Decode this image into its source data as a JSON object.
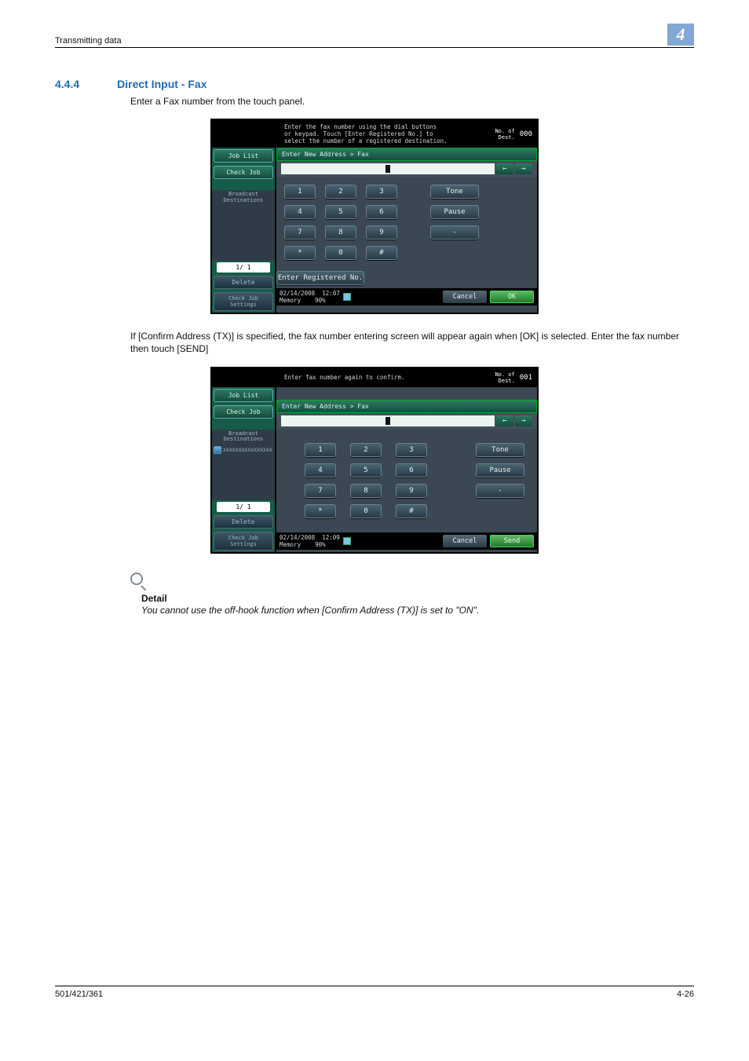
{
  "header": {
    "section": "Transmitting data",
    "chapter": "4"
  },
  "section": {
    "number": "4.4.4",
    "title": "Direct Input - Fax"
  },
  "p1": "Enter a Fax number from the touch panel.",
  "p2": "If [Confirm Address (TX)] is specified, the fax number entering screen will appear again when [OK] is selected. Enter the fax number then touch [SEND]",
  "detail": {
    "title": "Detail",
    "body": "You cannot use the off-hook function when [Confirm Address (TX)] is set to \"ON\"."
  },
  "footer": {
    "model": "501/421/361",
    "page": "4-26"
  },
  "screen1": {
    "job_list": "Job List",
    "check_job": "Check Job",
    "broadcast": "Broadcast\nDestinations",
    "page_indicator": "1/  1",
    "delete": "Delete",
    "check_settings": "Check Job\nSettings",
    "instruction": "Enter the fax number using the dial buttons\nor keypad. Touch [Enter Registered No.] to\nselect the number of a registered destination.",
    "dest_label": "No. of\nDest.",
    "dest_count": "000",
    "crumb": "Enter New Address > Fax",
    "keys": {
      "1": "1",
      "2": "2",
      "3": "3",
      "4": "4",
      "5": "5",
      "6": "6",
      "7": "7",
      "8": "8",
      "9": "9",
      "0": "0",
      "star": "*",
      "hash": "#",
      "tone": "Tone",
      "pause": "Pause",
      "dash": "-"
    },
    "enter_reg": "Enter Registered No.",
    "date": "02/14/2008",
    "time": "12:07",
    "memory_label": "Memory",
    "memory_val": "90%",
    "cancel": "Cancel",
    "ok": "OK"
  },
  "screen2": {
    "job_list": "Job List",
    "check_job": "Check Job",
    "broadcast": "Broadcast\nDestinations",
    "dest_entry": "XXXXXXXXXXXXXXXX",
    "page_indicator": "1/  1",
    "delete": "Delete",
    "check_settings": "Check Job\nSettings",
    "instruction": "Enter fax number again to confirm.",
    "dest_label": "No. of\nDest.",
    "dest_count": "001",
    "crumb": "Enter New Address > Fax",
    "keys": {
      "1": "1",
      "2": "2",
      "3": "3",
      "4": "4",
      "5": "5",
      "6": "6",
      "7": "7",
      "8": "8",
      "9": "9",
      "0": "0",
      "star": "*",
      "hash": "#",
      "tone": "Tone",
      "pause": "Pause",
      "dash": "-"
    },
    "date": "02/14/2008",
    "time": "12:09",
    "memory_label": "Memory",
    "memory_val": "90%",
    "cancel": "Cancel",
    "send": "Send"
  }
}
